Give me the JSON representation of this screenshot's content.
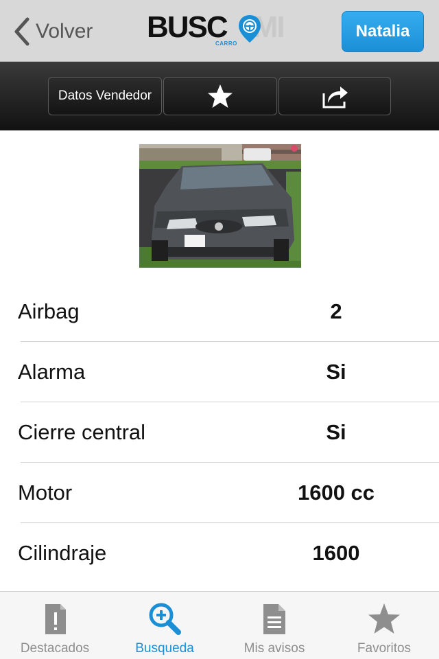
{
  "navbar": {
    "back_label": "Volver",
    "logo_main": "BUSC",
    "logo_end": "MI",
    "logo_sub": "CARRO",
    "user_label": "Natalia"
  },
  "toolbar": {
    "vendor_label": "Datos Vendedor"
  },
  "specs": [
    {
      "label": "Airbag",
      "value": "2"
    },
    {
      "label": "Alarma",
      "value": "Si"
    },
    {
      "label": "Cierre central",
      "value": "Si"
    },
    {
      "label": "Motor",
      "value": "1600 cc"
    },
    {
      "label": "Cilindraje",
      "value": "1600"
    }
  ],
  "tabs": [
    {
      "label": "Destacados",
      "icon": "alert-document-icon",
      "active": false
    },
    {
      "label": "Busqueda",
      "icon": "search-plus-icon",
      "active": true
    },
    {
      "label": "Mis avisos",
      "icon": "document-icon",
      "active": false
    },
    {
      "label": "Favoritos",
      "icon": "star-icon",
      "active": false
    }
  ],
  "colors": {
    "accent": "#1b8fd6",
    "tab_inactive": "#8e8e8e",
    "toolbar_bg": "#1e1e1e"
  }
}
